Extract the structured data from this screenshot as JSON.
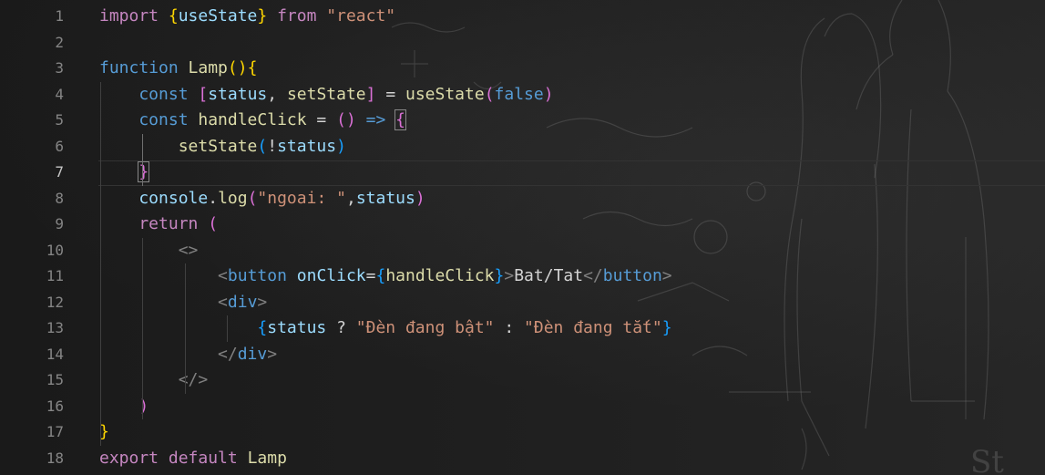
{
  "editor": {
    "lines": [
      {
        "number": "1",
        "tokens": [
          {
            "t": "import ",
            "c": "kw"
          },
          {
            "t": "{",
            "c": "b1"
          },
          {
            "t": "useState",
            "c": "var"
          },
          {
            "t": "}",
            "c": "b1"
          },
          {
            "t": " from ",
            "c": "kw"
          },
          {
            "t": "\"react\"",
            "c": "str"
          }
        ]
      },
      {
        "number": "2",
        "tokens": []
      },
      {
        "number": "3",
        "tokens": [
          {
            "t": "function ",
            "c": "kwb"
          },
          {
            "t": "Lamp",
            "c": "fn"
          },
          {
            "t": "()",
            "c": "b1"
          },
          {
            "t": "{",
            "c": "b1"
          }
        ]
      },
      {
        "number": "4",
        "tokens": [
          {
            "t": "    const ",
            "c": "kwb"
          },
          {
            "t": "[",
            "c": "b2"
          },
          {
            "t": "status",
            "c": "var"
          },
          {
            "t": ", ",
            "c": "txt"
          },
          {
            "t": "setState",
            "c": "fn"
          },
          {
            "t": "]",
            "c": "b2"
          },
          {
            "t": " = ",
            "c": "txt"
          },
          {
            "t": "useState",
            "c": "fn"
          },
          {
            "t": "(",
            "c": "b2"
          },
          {
            "t": "false",
            "c": "kwb"
          },
          {
            "t": ")",
            "c": "b2"
          }
        ]
      },
      {
        "number": "5",
        "tokens": [
          {
            "t": "    const ",
            "c": "kwb"
          },
          {
            "t": "handleClick",
            "c": "fn"
          },
          {
            "t": " = ",
            "c": "txt"
          },
          {
            "t": "()",
            "c": "b2"
          },
          {
            "t": " => ",
            "c": "kwb"
          },
          {
            "t": "{",
            "c": "b2 match"
          }
        ]
      },
      {
        "number": "6",
        "tokens": [
          {
            "t": "        setState",
            "c": "fn"
          },
          {
            "t": "(",
            "c": "b3"
          },
          {
            "t": "!",
            "c": "txt"
          },
          {
            "t": "status",
            "c": "var"
          },
          {
            "t": ")",
            "c": "b3"
          }
        ]
      },
      {
        "number": "7",
        "current": true,
        "tokens": [
          {
            "t": "    ",
            "c": "txt"
          },
          {
            "t": "}",
            "c": "b2 match"
          }
        ]
      },
      {
        "number": "8",
        "tokens": [
          {
            "t": "    console",
            "c": "var"
          },
          {
            "t": ".",
            "c": "txt"
          },
          {
            "t": "log",
            "c": "fn"
          },
          {
            "t": "(",
            "c": "b2"
          },
          {
            "t": "\"ngoai: \"",
            "c": "str"
          },
          {
            "t": ",",
            "c": "txt"
          },
          {
            "t": "status",
            "c": "var"
          },
          {
            "t": ")",
            "c": "b2"
          }
        ]
      },
      {
        "number": "9",
        "tokens": [
          {
            "t": "    return ",
            "c": "kw"
          },
          {
            "t": "(",
            "c": "b2"
          }
        ]
      },
      {
        "number": "10",
        "tokens": [
          {
            "t": "        <>",
            "c": "ang"
          }
        ]
      },
      {
        "number": "11",
        "tokens": [
          {
            "t": "            <",
            "c": "ang"
          },
          {
            "t": "button",
            "c": "tag"
          },
          {
            "t": " ",
            "c": "txt"
          },
          {
            "t": "onClick",
            "c": "var"
          },
          {
            "t": "=",
            "c": "txt"
          },
          {
            "t": "{",
            "c": "b3"
          },
          {
            "t": "handleClick",
            "c": "fn"
          },
          {
            "t": "}",
            "c": "b3"
          },
          {
            "t": ">",
            "c": "ang"
          },
          {
            "t": "Bat/Tat",
            "c": "txt"
          },
          {
            "t": "</",
            "c": "ang"
          },
          {
            "t": "button",
            "c": "tag"
          },
          {
            "t": ">",
            "c": "ang"
          }
        ]
      },
      {
        "number": "12",
        "tokens": [
          {
            "t": "            <",
            "c": "ang"
          },
          {
            "t": "div",
            "c": "tag"
          },
          {
            "t": ">",
            "c": "ang"
          }
        ]
      },
      {
        "number": "13",
        "tokens": [
          {
            "t": "                ",
            "c": "txt"
          },
          {
            "t": "{",
            "c": "b3"
          },
          {
            "t": "status",
            "c": "var"
          },
          {
            "t": " ? ",
            "c": "txt"
          },
          {
            "t": "\"Đèn đang bật\"",
            "c": "str"
          },
          {
            "t": " : ",
            "c": "txt"
          },
          {
            "t": "\"Đèn đang tắt\"",
            "c": "str"
          },
          {
            "t": "}",
            "c": "b3"
          }
        ]
      },
      {
        "number": "14",
        "tokens": [
          {
            "t": "            </",
            "c": "ang"
          },
          {
            "t": "div",
            "c": "tag"
          },
          {
            "t": ">",
            "c": "ang"
          }
        ]
      },
      {
        "number": "15",
        "tokens": [
          {
            "t": "        </>",
            "c": "ang"
          }
        ]
      },
      {
        "number": "16",
        "tokens": [
          {
            "t": "    )",
            "c": "b2"
          }
        ]
      },
      {
        "number": "17",
        "tokens": [
          {
            "t": "}",
            "c": "b1"
          }
        ]
      },
      {
        "number": "18",
        "tokens": [
          {
            "t": "export ",
            "c": "kw"
          },
          {
            "t": "default ",
            "c": "kw"
          },
          {
            "t": "Lamp",
            "c": "fn"
          }
        ]
      }
    ]
  },
  "background": {
    "description_icon": "anime-couple-wallpaper-icon"
  }
}
